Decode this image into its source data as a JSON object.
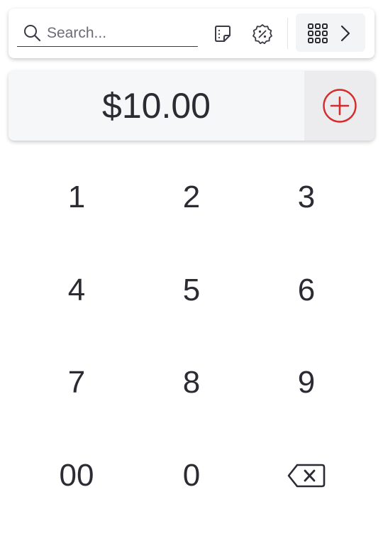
{
  "search": {
    "placeholder": "Search...",
    "value": ""
  },
  "toolbar": {
    "note_icon": "sticky-note-icon",
    "discount_icon": "discount-badge-icon",
    "library_icon": "grid-icon",
    "library_chevron": "chevron-right-icon"
  },
  "amount": {
    "value": "$10.00",
    "add_icon": "plus-circle-icon"
  },
  "keypad": {
    "keys": [
      {
        "label": "1"
      },
      {
        "label": "2"
      },
      {
        "label": "3"
      },
      {
        "label": "4"
      },
      {
        "label": "5"
      },
      {
        "label": "6"
      },
      {
        "label": "7"
      },
      {
        "label": "8"
      },
      {
        "label": "9"
      },
      {
        "label": "00"
      },
      {
        "label": "0"
      },
      {
        "icon": "backspace-icon"
      }
    ]
  },
  "colors": {
    "accent": "#d52b2b",
    "text": "#2b2b33"
  }
}
